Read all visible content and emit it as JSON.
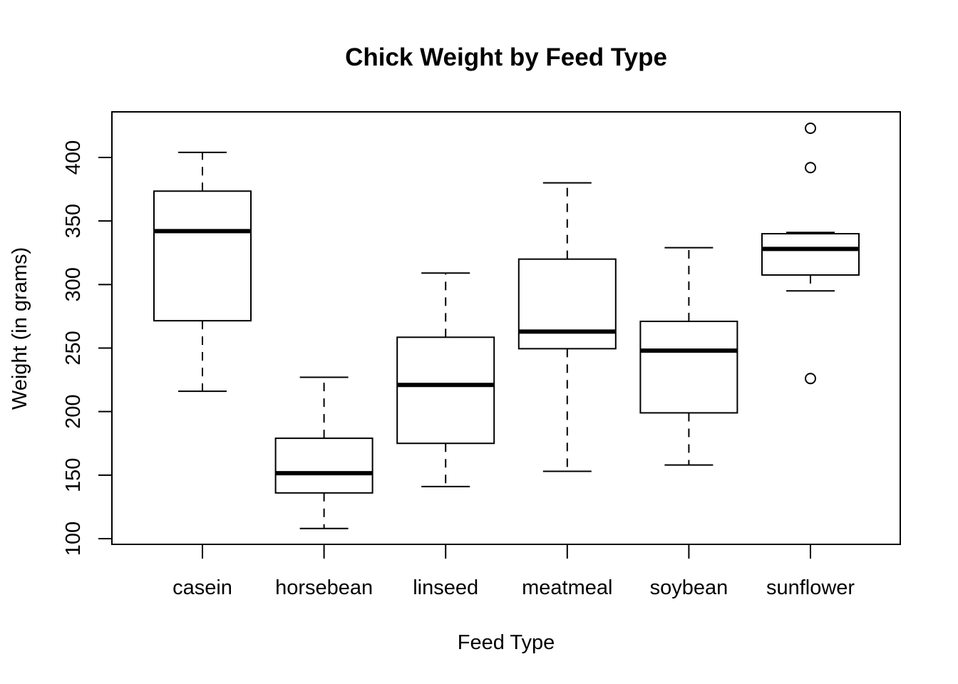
{
  "chart_data": {
    "type": "boxplot",
    "title": "Chick Weight by Feed Type",
    "xlabel": "Feed Type",
    "ylabel": "Weight (in grams)",
    "ylim": [
      95,
      436
    ],
    "yticks": [
      100,
      150,
      200,
      250,
      300,
      350,
      400
    ],
    "grid": false,
    "categories": [
      "casein",
      "horsebean",
      "linseed",
      "meatmeal",
      "soybean",
      "sunflower"
    ],
    "boxes": [
      {
        "name": "casein",
        "lower_whisker": 216,
        "q1": 271.5,
        "median": 342,
        "q3": 373.5,
        "upper_whisker": 404,
        "outliers": []
      },
      {
        "name": "horsebean",
        "lower_whisker": 108,
        "q1": 136,
        "median": 151.5,
        "q3": 179,
        "upper_whisker": 227,
        "outliers": []
      },
      {
        "name": "linseed",
        "lower_whisker": 141,
        "q1": 175,
        "median": 221,
        "q3": 258.5,
        "upper_whisker": 309,
        "outliers": []
      },
      {
        "name": "meatmeal",
        "lower_whisker": 153,
        "q1": 249.5,
        "median": 263,
        "q3": 320,
        "upper_whisker": 380,
        "outliers": []
      },
      {
        "name": "soybean",
        "lower_whisker": 158,
        "q1": 199,
        "median": 248,
        "q3": 271,
        "upper_whisker": 329,
        "outliers": []
      },
      {
        "name": "sunflower",
        "lower_whisker": 295,
        "q1": 307.5,
        "median": 328,
        "q3": 340,
        "upper_whisker": 341,
        "outliers": [
          423,
          392,
          226
        ]
      }
    ]
  }
}
